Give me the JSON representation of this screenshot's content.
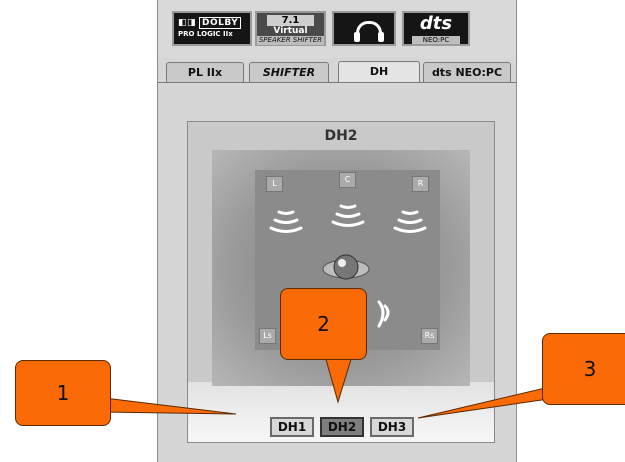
{
  "logos": {
    "dolby_top": "DOLBY",
    "dolby_sub": "PRO LOGIC IIx",
    "virtual_line1": "7.1",
    "virtual_line2": "Virtual",
    "virtual_line3": "SPEAKER SHIFTER",
    "dts_big": "dts",
    "dts_small": "NEO:PC"
  },
  "tabs": [
    {
      "label": "PL IIx",
      "active": false
    },
    {
      "label": "SHIFTER",
      "active": false
    },
    {
      "label": "DH",
      "active": true
    },
    {
      "label": "dts NEO:PC",
      "active": false
    }
  ],
  "room": {
    "title": "DH2",
    "speakers": {
      "left": "L",
      "center": "C",
      "right": "R",
      "left_surround": "Ls",
      "right_surround": "Rs"
    }
  },
  "dh_buttons": [
    {
      "label": "DH1",
      "selected": false
    },
    {
      "label": "DH2",
      "selected": true
    },
    {
      "label": "DH3",
      "selected": false
    }
  ],
  "callouts": [
    {
      "label": "1"
    },
    {
      "label": "2"
    },
    {
      "label": "3"
    }
  ],
  "colors": {
    "callout": "#fa6a06",
    "panel": "#d6d6d6"
  }
}
